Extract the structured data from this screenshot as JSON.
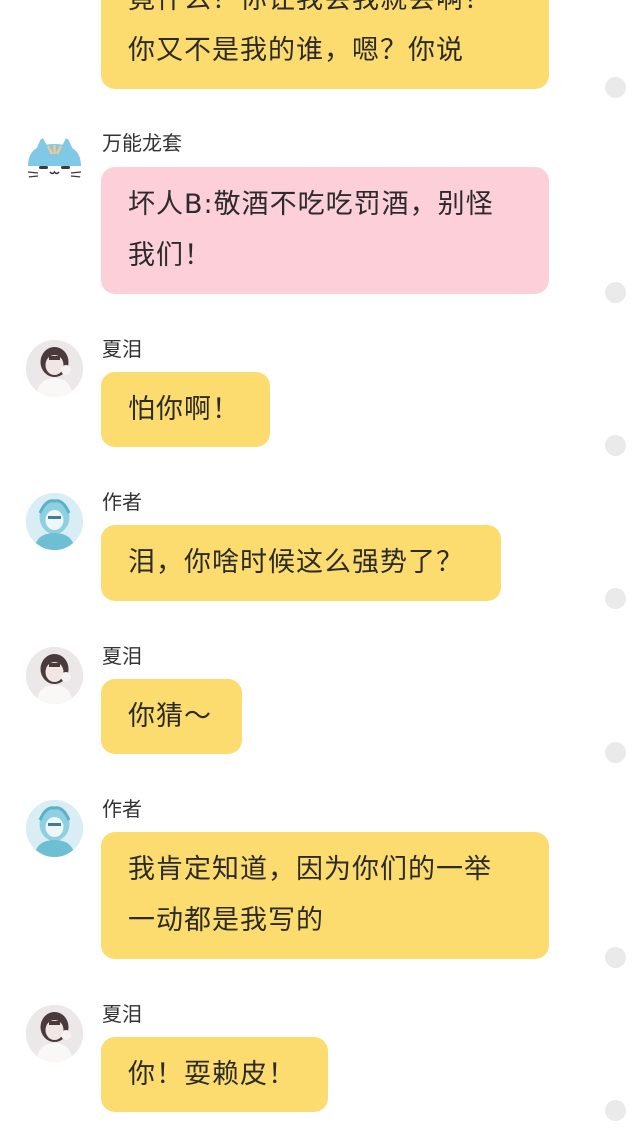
{
  "messages": [
    {
      "sender": "",
      "color": "yellow",
      "lines": [
        "竟什么？你让我会我就会啊？",
        "你又不是我的谁，嗯？你说"
      ]
    },
    {
      "sender": "万能龙套",
      "color": "pink",
      "lines": [
        "坏人B:敬酒不吃吃罚酒，别怪",
        "我们！"
      ]
    },
    {
      "sender": "夏泪",
      "color": "yellow",
      "lines": [
        "怕你啊！"
      ]
    },
    {
      "sender": "作者",
      "color": "yellow",
      "lines": [
        "泪，你啥时候这么强势了？"
      ]
    },
    {
      "sender": "夏泪",
      "color": "yellow",
      "lines": [
        "你猜～"
      ]
    },
    {
      "sender": "作者",
      "color": "yellow",
      "lines": [
        "我肯定知道，因为你们的一举",
        "一动都是我写的"
      ]
    },
    {
      "sender": "夏泪",
      "color": "yellow",
      "lines": [
        "你！耍赖皮！"
      ]
    }
  ],
  "avatars": {
    "cat": "cat-avatar-icon",
    "girl": "girl-avatar-icon",
    "author": "author-avatar-icon"
  },
  "colors": {
    "yellow_bubble": "#fcdc6e",
    "pink_bubble": "#fccfd9",
    "dot": "#eaeaea"
  }
}
